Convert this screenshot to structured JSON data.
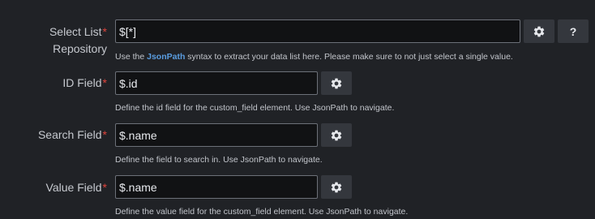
{
  "fields": {
    "list": {
      "label_line1": "Select List",
      "label_line2": "Repository",
      "required_mark": "*",
      "value": "$[*]",
      "help_before": "Use the ",
      "help_link": "JsonPath",
      "help_after": " syntax to extract your data list here. Please make sure to not just select a single value.",
      "help_button_label": "?"
    },
    "id": {
      "label": "ID Field",
      "required_mark": "*",
      "value": "$.id",
      "help": "Define the id field for the custom_field element. Use JsonPath to navigate."
    },
    "search": {
      "label": "Search Field",
      "required_mark": "*",
      "value": "$.name",
      "help": "Define the field to search in. Use JsonPath to navigate."
    },
    "value": {
      "label": "Value Field",
      "required_mark": "*",
      "value": "$.name",
      "help": "Define the value field for the custom_field element. Use JsonPath to navigate."
    }
  },
  "icons": {
    "settings": "gear-icon",
    "help": "question-icon"
  },
  "colors": {
    "background": "#202226",
    "required": "#e0443c",
    "link": "#5a9de0",
    "input_bg": "#111214",
    "input_border": "#6c7078",
    "button_bg": "#34373d"
  }
}
